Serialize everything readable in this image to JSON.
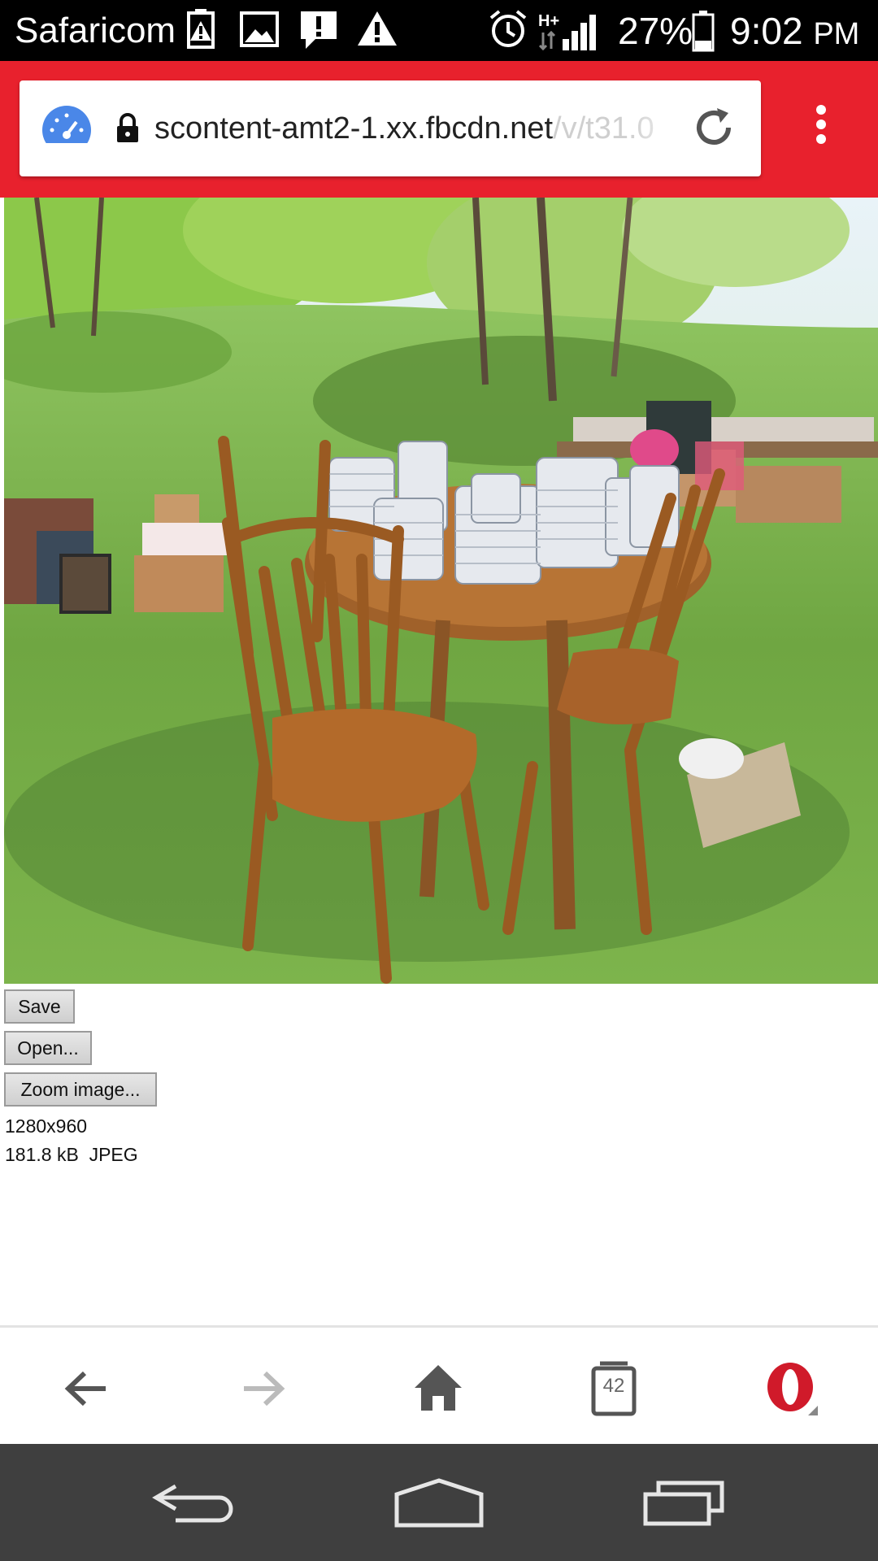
{
  "status_bar": {
    "carrier": "Safaricom",
    "network": "H+",
    "battery": "27%",
    "time": "9:02",
    "ampm": "PM",
    "icons": [
      "battery-alert-icon",
      "image-notification-icon",
      "message-alert-icon",
      "warning-icon",
      "alarm-icon",
      "signal-icon",
      "battery-icon"
    ]
  },
  "browser": {
    "url_host": "scontent-amt2-1.xx.fbcdn.net",
    "url_path": "/v/t31.0",
    "speed_icon": "data-savings-icon",
    "lock_icon": "lock-icon",
    "reload_icon": "reload-icon",
    "menu_icon": "more-vert-icon",
    "accent": "#e8212d"
  },
  "image_page": {
    "save_label": "Save",
    "open_label": "Open...",
    "zoom_label": "Zoom image...",
    "dimensions": "1280x960",
    "size_type": "181.8 kB  JPEG"
  },
  "bottom_bar": {
    "tab_count": "42",
    "icons": [
      "back-arrow-icon",
      "forward-arrow-icon",
      "home-icon",
      "tabs-icon",
      "opera-menu-icon"
    ]
  },
  "nav_bar": {
    "icons": [
      "system-back-icon",
      "system-home-icon",
      "recents-icon"
    ]
  }
}
